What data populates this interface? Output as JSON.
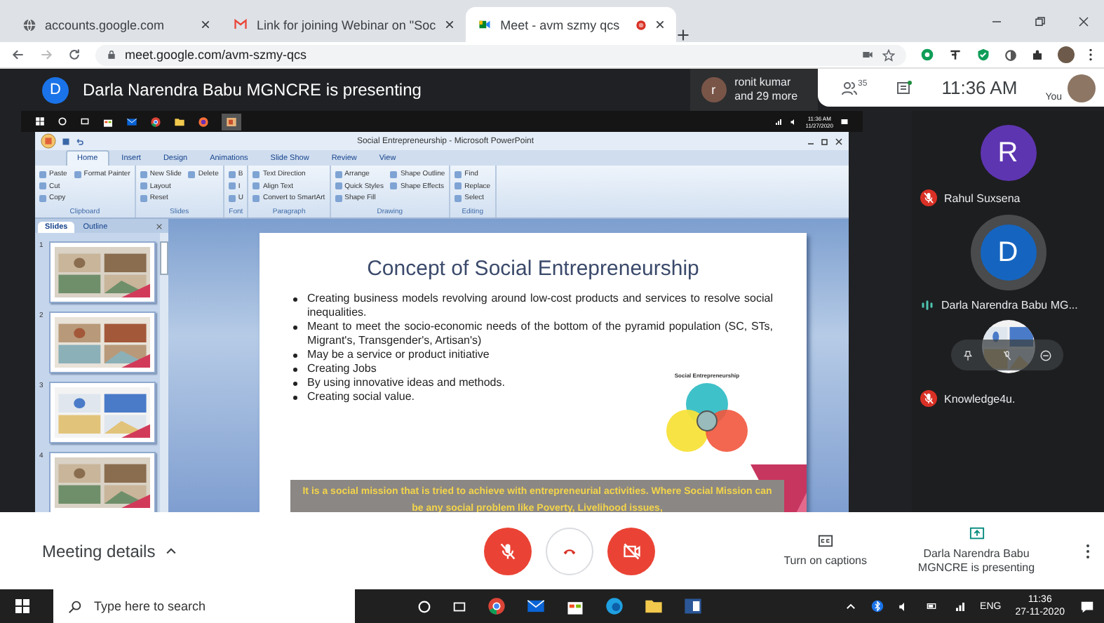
{
  "browser": {
    "tabs": [
      {
        "label": "accounts.google.com",
        "selected": false
      },
      {
        "label": "Link for joining Webinar on \"Soc",
        "selected": false
      },
      {
        "label": "Meet - avm szmy qcs",
        "selected": true
      }
    ],
    "address": "meet.google.com/avm-szmy-qcs"
  },
  "meet_header": {
    "presenter_initial": "D",
    "presenter_text": "Darla Narendra Babu MGNCRE is presenting",
    "chip": {
      "initial": "r",
      "name": "ronit kumar",
      "more": "and 29 more"
    },
    "people_count": "35",
    "time": "11:36 AM",
    "you_label": "You"
  },
  "shared_screen": {
    "taskbar": {
      "time": "11:36 AM",
      "date": "11/27/2020"
    },
    "window_title": "Social Entrepreneurship - Microsoft PowerPoint",
    "ribbon_tabs": [
      {
        "label": "Home",
        "selected": true
      },
      {
        "label": "Insert",
        "selected": false
      },
      {
        "label": "Design",
        "selected": false
      },
      {
        "label": "Animations",
        "selected": false
      },
      {
        "label": "Slide Show",
        "selected": false
      },
      {
        "label": "Review",
        "selected": false
      },
      {
        "label": "View",
        "selected": false
      }
    ],
    "ribbon_groups": [
      {
        "name": "Clipboard",
        "items": [
          "Paste",
          "Cut",
          "Copy",
          "Format Painter"
        ]
      },
      {
        "name": "Slides",
        "items": [
          "New Slide",
          "Layout",
          "Reset",
          "Delete"
        ]
      },
      {
        "name": "Font",
        "items": [
          "B",
          "I",
          "U"
        ]
      },
      {
        "name": "Paragraph",
        "items": [
          "Text Direction",
          "Align Text",
          "Convert to SmartArt"
        ]
      },
      {
        "name": "Drawing",
        "items": [
          "Arrange",
          "Quick Styles",
          "Shape Fill",
          "Shape Outline",
          "Shape Effects"
        ]
      },
      {
        "name": "Editing",
        "items": [
          "Find",
          "Replace",
          "Select"
        ]
      }
    ],
    "pane_tabs": [
      {
        "label": "Slides",
        "selected": true
      },
      {
        "label": "Outline",
        "selected": false
      }
    ],
    "thumbnails": [
      {
        "number": "1"
      },
      {
        "number": "2"
      },
      {
        "number": "3"
      },
      {
        "number": "4"
      }
    ],
    "slide": {
      "title": "Concept of Social Entrepreneurship",
      "bullets": [
        "Creating business models revolving around low-cost products and services to resolve social inequalities.",
        "Meant to meet the socio-economic  needs  of the bottom of the pyramid population (SC, STs, Migrant's, Transgender's, Artisan's)",
        "May be a service or product initiative",
        "Creating Jobs",
        "By using innovative ideas and methods.",
        "Creating social value."
      ],
      "diagram_title": "Social Entrepreneurship",
      "caption": "It is a social mission that is tried to achieve with entrepreneurial activities. Where Social Mission can be any social problem like Poverty, Livelihood issues,"
    }
  },
  "participants": [
    {
      "kind": "initial",
      "initial": "R",
      "color": "#5e35b1",
      "name": "Rahul Suxsena",
      "muted": true,
      "speaking": false
    },
    {
      "kind": "initial",
      "initial": "D",
      "color": "#1565c0",
      "name": "Darla Narendra Babu MG...",
      "muted": false,
      "speaking": true
    },
    {
      "kind": "picture",
      "name": "Knowledge4u.",
      "muted": true,
      "speaking": false
    }
  ],
  "controls": {
    "meeting_details": "Meeting details",
    "captions": "Turn on captions",
    "presenting": "Darla Narendra Babu MGNCRE is presenting"
  },
  "taskbar": {
    "search_placeholder": "Type here to search",
    "language": "ENG",
    "time": "11:36",
    "date": "27-11-2020"
  }
}
